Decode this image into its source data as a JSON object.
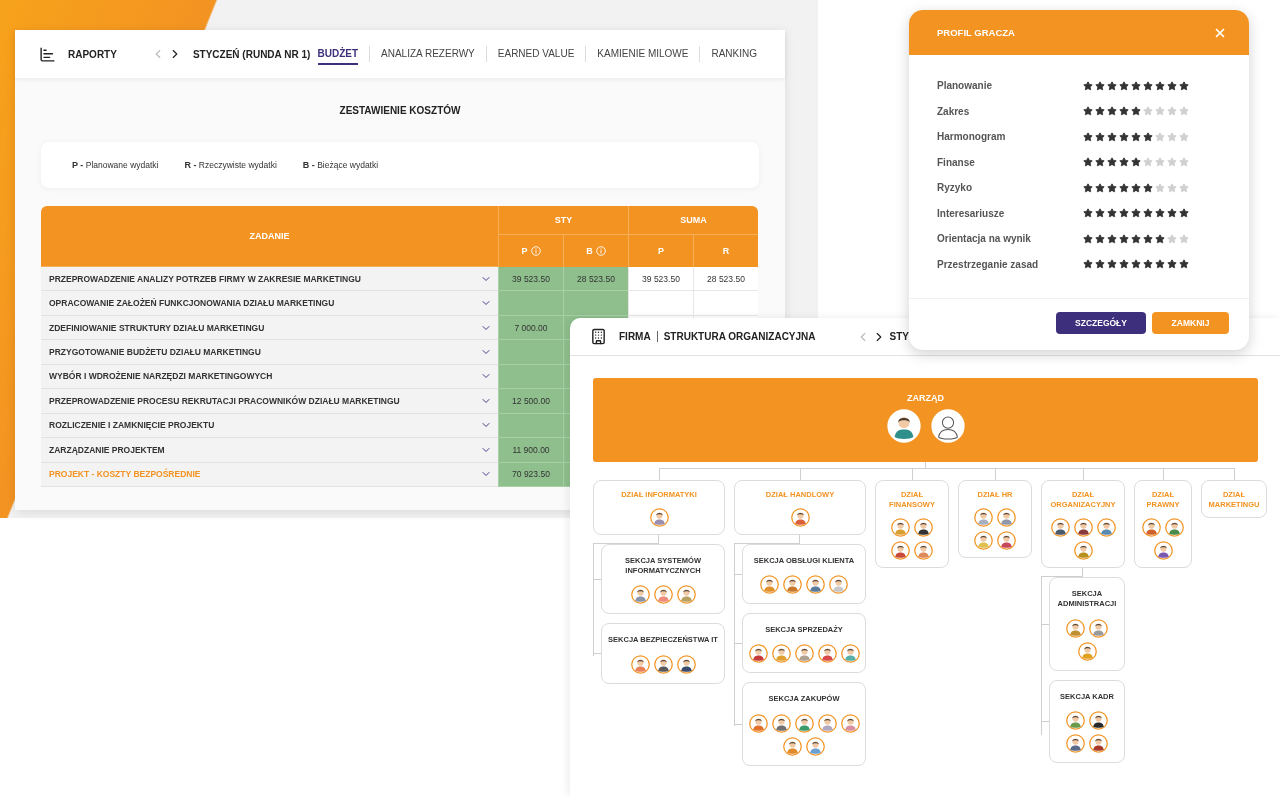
{
  "reports": {
    "title": "RAPORTY",
    "period": "STYCZEŃ (RUNDA NR 1)",
    "tabs": [
      {
        "label": "BUDŻET",
        "selected": true
      },
      {
        "label": "ANALIZA REZERWY",
        "selected": false
      },
      {
        "label": "EARNED VALUE",
        "selected": false
      },
      {
        "label": "KAMIENIE MILOWE",
        "selected": false
      },
      {
        "label": "RANKING",
        "selected": false
      }
    ],
    "heading": "ZESTAWIENIE KOSZTÓW",
    "legend": [
      {
        "key": "P -",
        "text": "Planowane wydatki"
      },
      {
        "key": "R -",
        "text": "Rzeczywiste wydatki"
      },
      {
        "key": "B -",
        "text": "Bieżące wydatki"
      }
    ],
    "table": {
      "task_header": "ZADANIE",
      "groups": [
        {
          "label": "STY",
          "highlight": true,
          "columns": [
            {
              "label": "P",
              "info": true
            },
            {
              "label": "B",
              "info": true
            }
          ]
        },
        {
          "label": "SUMA",
          "highlight": false,
          "columns": [
            {
              "label": "P",
              "info": false
            },
            {
              "label": "R",
              "info": false
            }
          ]
        }
      ],
      "rows": [
        {
          "task": "PRZEPROWADZENIE ANALIZY POTRZEB FIRMY W ZAKRESIE MARKETINGU",
          "kind": "task",
          "values": {
            "sty_p": "39 523.50",
            "sty_b": "28 523.50",
            "suma_p": "39 523.50",
            "suma_r": "28 523.50"
          }
        },
        {
          "task": "OPRACOWANIE ZAŁOŻEŃ FUNKCJONOWANIA DZIAŁU MARKETINGU",
          "kind": "task"
        },
        {
          "task": "ZDEFINIOWANIE STRUKTURY DZIAŁU MARKETINGU",
          "kind": "task",
          "values": {
            "sty_p": "7 000.00"
          }
        },
        {
          "task": "PRZYGOTOWANIE BUDŻETU DZIAŁU MARKETINGU",
          "kind": "task"
        },
        {
          "task": "WYBÓR I WDROŻENIE NARZĘDZI MARKETINGOWYCH",
          "kind": "task"
        },
        {
          "task": "PRZEPROWADZENIE PROCESU REKRUTACJI PRACOWNIKÓW DZIAŁU MARKETINGU",
          "kind": "task",
          "values": {
            "sty_p": "12 500.00"
          }
        },
        {
          "task": "ROZLICZENIE I ZAMKNIĘCIE PROJEKTU",
          "kind": "task"
        },
        {
          "task": "ZARZĄDZANIE PROJEKTEM",
          "kind": "task",
          "values": {
            "sty_p": "11 900.00"
          }
        },
        {
          "task": "PROJEKT - KOSZTY BEZPOŚREDNIE",
          "kind": "total",
          "values": {
            "sty_p": "70 923.50"
          }
        }
      ]
    }
  },
  "organization": {
    "section": "FIRMA",
    "title": "STRUKTURA ORGANIZACYJNA",
    "period": "STY",
    "board": {
      "title": "ZARZĄD",
      "avatars": [
        {
          "color": "#2f8f8a"
        },
        {
          "color": "#ffffff"
        }
      ]
    },
    "departments": [
      {
        "title": "DZIAŁ INFORMATYKI",
        "avatars": [
          {
            "color": "#9a8fb0"
          }
        ],
        "sections": [
          {
            "title": "SEKCJA SYSTEMÓW INFORMATYCZNYCH",
            "avatars": [
              {
                "color": "#8a94a8"
              },
              {
                "color": "#f08a7a"
              },
              {
                "color": "#b8a060"
              }
            ]
          },
          {
            "title": "SEKCJA BEZPIECZEŃSTWA IT",
            "avatars": [
              {
                "color": "#e8805a"
              },
              {
                "color": "#5a5a5a"
              },
              {
                "color": "#3a4a6a"
              }
            ]
          }
        ]
      },
      {
        "title": "DZIAŁ HANDLOWY",
        "avatars": [
          {
            "color": "#d9603a"
          }
        ],
        "sections": [
          {
            "title": "SEKCJA OBSŁUGI KLIENTA",
            "avatars": [
              {
                "color": "#e0902a"
              },
              {
                "color": "#c8782a"
              },
              {
                "color": "#5a7a9a"
              },
              {
                "color": "#c8c8c8"
              }
            ]
          },
          {
            "title": "SEKCJA SPRZEDAŻY",
            "avatars": [
              {
                "color": "#c83a3a"
              },
              {
                "color": "#e0a030"
              },
              {
                "color": "#b0a090"
              },
              {
                "color": "#d84a4a"
              },
              {
                "color": "#5ab0a8"
              }
            ]
          },
          {
            "title": "SEKCJA ZAKUPÓW",
            "avatars": [
              {
                "color": "#e0702a"
              },
              {
                "color": "#707070"
              },
              {
                "color": "#3a9a6a"
              },
              {
                "color": "#b0a8c0"
              },
              {
                "color": "#d890a0"
              },
              {
                "color": "#e08a2a"
              },
              {
                "color": "#6aa0d0"
              }
            ]
          }
        ]
      },
      {
        "title": "DZIAŁ FINANSOWY",
        "avatars": [
          {
            "color": "#d8a030"
          },
          {
            "color": "#333333"
          },
          {
            "color": "#c84a3a"
          },
          {
            "color": "#e08a5a"
          }
        ]
      },
      {
        "title": "DZIAŁ HR",
        "avatars": [
          {
            "color": "#a8b0c0"
          },
          {
            "color": "#9098a8"
          },
          {
            "color": "#e0c050"
          },
          {
            "color": "#c84a5a"
          }
        ]
      },
      {
        "title": "DZIAŁ ORGANIZACYJNY",
        "avatars": [
          {
            "color": "#4a5a6a"
          },
          {
            "color": "#8a3a3a"
          },
          {
            "color": "#5a8ab0"
          },
          {
            "color": "#b89020"
          }
        ],
        "sections": [
          {
            "title": "SEKCJA ADMINISTRACJI",
            "avatars": [
              {
                "color": "#c09030"
              },
              {
                "color": "#9a9a9a"
              },
              {
                "color": "#e0a020"
              }
            ]
          },
          {
            "title": "SEKCJA KADR",
            "avatars": [
              {
                "color": "#6a9a4a"
              },
              {
                "color": "#2a2a2a"
              },
              {
                "color": "#5a6a8a"
              },
              {
                "color": "#a83a2a"
              }
            ]
          }
        ]
      },
      {
        "title": "DZIAŁ PRAWNY",
        "avatars": [
          {
            "color": "#d0602a"
          },
          {
            "color": "#4a8a4a"
          },
          {
            "color": "#7a5ab0"
          }
        ]
      },
      {
        "title": "DZIAŁ MARKETINGU"
      }
    ]
  },
  "player_profile": {
    "title": "PROFIL GRACZA",
    "skills": [
      {
        "label": "Planowanie",
        "stars": 9
      },
      {
        "label": "Zakres",
        "stars": 5
      },
      {
        "label": "Harmonogram",
        "stars": 6
      },
      {
        "label": "Finanse",
        "stars": 5
      },
      {
        "label": "Ryzyko",
        "stars": 6
      },
      {
        "label": "Interesariusze",
        "stars": 9
      },
      {
        "label": "Orientacja na wynik",
        "stars": 7
      },
      {
        "label": "Przestrzeganie zasad",
        "stars": 9
      }
    ],
    "buttons": [
      {
        "label": "SZCZEGÓŁY",
        "kind": "primary"
      },
      {
        "label": "ZAMKNIJ",
        "kind": "secondary"
      }
    ]
  }
}
